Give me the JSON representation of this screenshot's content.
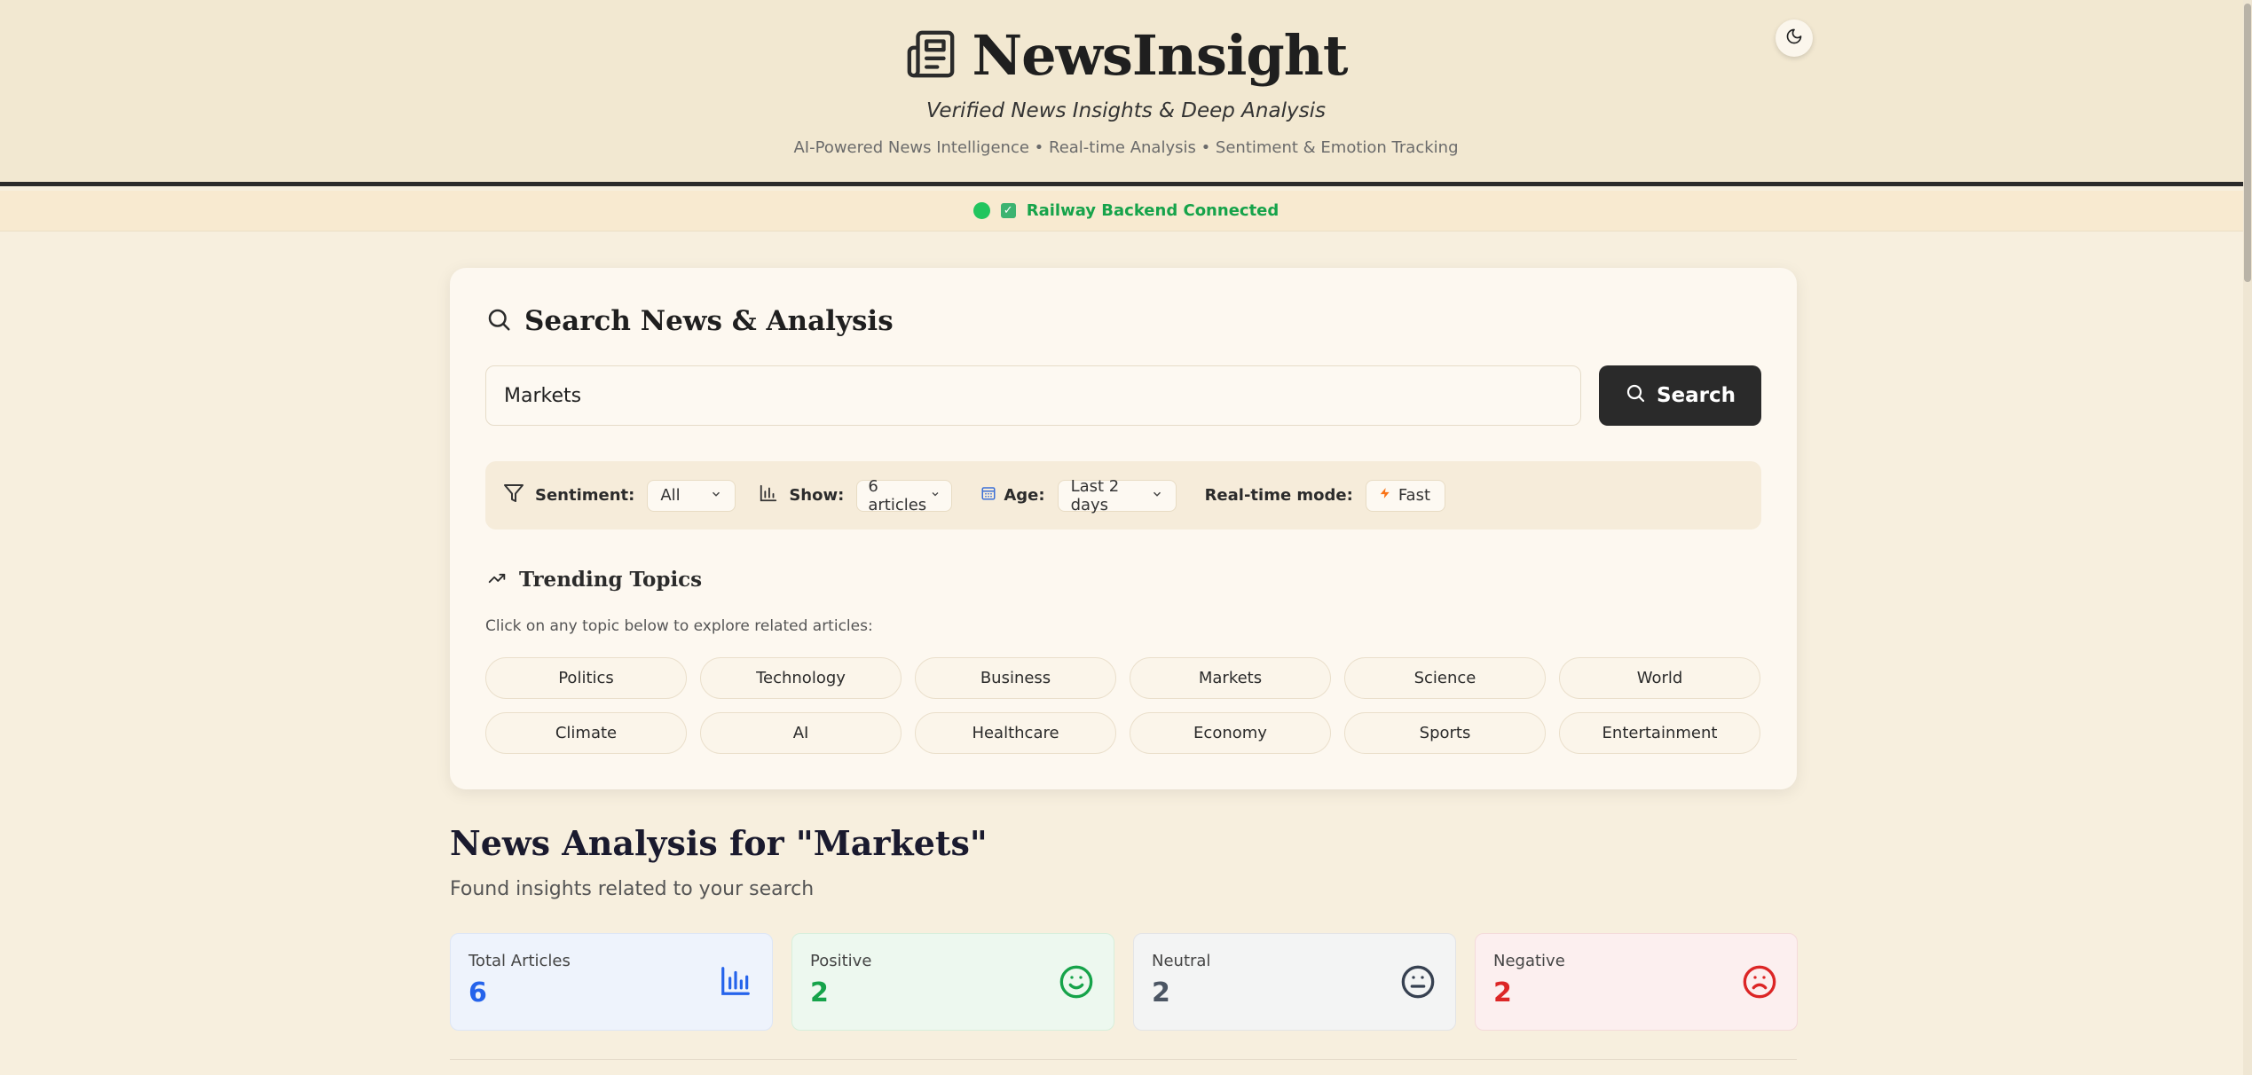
{
  "header": {
    "title": "NewsInsight",
    "tagline": "Verified News Insights & Deep Analysis",
    "subline": "AI-Powered News Intelligence • Real-time Analysis • Sentiment & Emotion Tracking",
    "logo_icon": "newspaper-icon",
    "theme_toggle_icon": "moon-icon"
  },
  "status": {
    "text": "Railway Backend Connected",
    "color": "#16a34a"
  },
  "search": {
    "title": "Search News & Analysis",
    "query": "Markets",
    "button_label": "Search"
  },
  "filters": {
    "sentiment_label": "Sentiment:",
    "sentiment_value": "All",
    "show_label": "Show:",
    "show_value": "6 articles",
    "age_label": "Age:",
    "age_value": "Last 2 days",
    "realtime_label": "Real-time mode:",
    "realtime_value": "Fast"
  },
  "trending": {
    "title": "Trending Topics",
    "hint": "Click on any topic below to explore related articles:",
    "topics": [
      "Politics",
      "Technology",
      "Business",
      "Markets",
      "Science",
      "World",
      "Climate",
      "AI",
      "Healthcare",
      "Economy",
      "Sports",
      "Entertainment"
    ]
  },
  "results": {
    "title": "News Analysis for \"Markets\"",
    "subtitle": "Found insights related to your search"
  },
  "stats": {
    "total": {
      "label": "Total Articles",
      "value": "6",
      "color": "#2563eb"
    },
    "positive": {
      "label": "Positive",
      "value": "2",
      "color": "#16a34a"
    },
    "neutral": {
      "label": "Neutral",
      "value": "2",
      "color": "#4b5563"
    },
    "negative": {
      "label": "Negative",
      "value": "2",
      "color": "#dc2626"
    }
  }
}
